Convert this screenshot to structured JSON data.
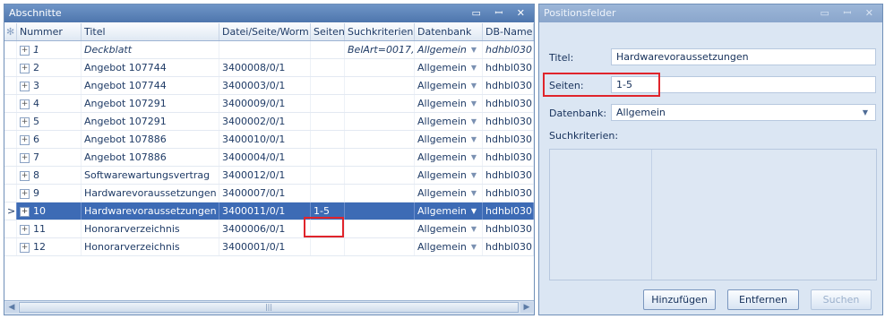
{
  "left_panel": {
    "title": "Abschnitte",
    "buttons": "▭ ꟷ ✕",
    "columns": [
      "Nummer",
      "Titel",
      "Datei/Seite/Worm",
      "Seiten",
      "Suchkriterien",
      "Datenbank",
      "DB-Name"
    ],
    "header_marker": "✻",
    "rows": [
      {
        "nummer": "1",
        "titel": "Deckblatt",
        "datei": "",
        "seiten": "",
        "such": "BelArt=0017,",
        "datenbank": "Allgemein",
        "dbname": "hdhbl030"
      },
      {
        "nummer": "2",
        "titel": "Angebot 107744",
        "datei": "3400008/0/1",
        "seiten": "",
        "such": "",
        "datenbank": "Allgemein",
        "dbname": "hdhbl030"
      },
      {
        "nummer": "3",
        "titel": "Angebot 107744",
        "datei": "3400003/0/1",
        "seiten": "",
        "such": "",
        "datenbank": "Allgemein",
        "dbname": "hdhbl030"
      },
      {
        "nummer": "4",
        "titel": "Angebot 107291",
        "datei": "3400009/0/1",
        "seiten": "",
        "such": "",
        "datenbank": "Allgemein",
        "dbname": "hdhbl030"
      },
      {
        "nummer": "5",
        "titel": "Angebot 107291",
        "datei": "3400002/0/1",
        "seiten": "",
        "such": "",
        "datenbank": "Allgemein",
        "dbname": "hdhbl030"
      },
      {
        "nummer": "6",
        "titel": "Angebot 107886",
        "datei": "3400010/0/1",
        "seiten": "",
        "such": "",
        "datenbank": "Allgemein",
        "dbname": "hdhbl030"
      },
      {
        "nummer": "7",
        "titel": "Angebot 107886",
        "datei": "3400004/0/1",
        "seiten": "",
        "such": "",
        "datenbank": "Allgemein",
        "dbname": "hdhbl030"
      },
      {
        "nummer": "8",
        "titel": "Softwarewartungsvertrag",
        "datei": "3400012/0/1",
        "seiten": "",
        "such": "",
        "datenbank": "Allgemein",
        "dbname": "hdhbl030"
      },
      {
        "nummer": "9",
        "titel": "Hardwarevoraussetzungen",
        "datei": "3400007/0/1",
        "seiten": "",
        "such": "",
        "datenbank": "Allgemein",
        "dbname": "hdhbl030"
      },
      {
        "nummer": "10",
        "titel": "Hardwarevoraussetzungen",
        "datei": "3400011/0/1",
        "seiten": "1-5",
        "such": "",
        "datenbank": "Allgemein",
        "dbname": "hdhbl030"
      },
      {
        "nummer": "11",
        "titel": "Honorarverzeichnis",
        "datei": "3400006/0/1",
        "seiten": "",
        "such": "",
        "datenbank": "Allgemein",
        "dbname": "hdhbl030"
      },
      {
        "nummer": "12",
        "titel": "Honorarverzeichnis",
        "datei": "3400001/0/1",
        "seiten": "",
        "such": "",
        "datenbank": "Allgemein",
        "dbname": "hdhbl030"
      }
    ]
  },
  "right_panel": {
    "title": "Positionsfelder",
    "buttons": "▭ ꟷ ✕",
    "titel_label": "Titel:",
    "titel_value": "Hardwarevoraussetzungen",
    "seiten_label": "Seiten:",
    "seiten_value": "1-5",
    "datenbank_label": "Datenbank:",
    "datenbank_value": "Allgemein",
    "suchkriterien_label": "Suchkriterien:",
    "btn_add": "Hinzufügen",
    "btn_remove": "Entfernen",
    "btn_search": "Suchen"
  },
  "colors": {
    "selection": "#3d6bb5",
    "highlight_box": "#e0242b",
    "titlebar": "#4e76ad"
  }
}
